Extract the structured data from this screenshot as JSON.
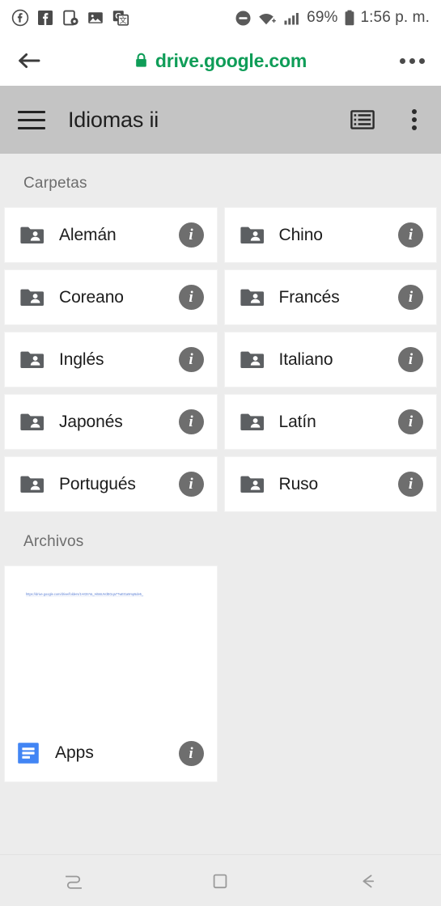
{
  "status_bar": {
    "icons_left": [
      {
        "name": "facebook-circle-icon",
        "glyph": "f"
      },
      {
        "name": "facebook-square-icon",
        "glyph": "f"
      },
      {
        "name": "screen-recorder-icon",
        "glyph": "□"
      },
      {
        "name": "photos-icon",
        "glyph": "ὛC"
      },
      {
        "name": "google-translate-icon",
        "glyph": "G"
      }
    ],
    "do_not_disturb": "do-not-disturb-icon",
    "wifi": "wifi-icon",
    "signal": "cellular-signal-icon",
    "battery_percent": "69%",
    "battery_icon": "battery-icon",
    "time": "1:56 p. m."
  },
  "browser": {
    "back_label": "back-arrow",
    "lock_label": "secure-lock",
    "url": "drive.google.com",
    "url_color": "#0f9d58",
    "menu_label": "browser-overflow-menu"
  },
  "app_bar": {
    "menu_label": "menu",
    "title": "Idiomas ii",
    "view_toggle_label": "list-view",
    "overflow_label": "more-options",
    "background": "#c4c4c4"
  },
  "folders_section": {
    "header": "Carpetas",
    "items": [
      {
        "label": "Alemán",
        "icon": "shared-folder-icon",
        "info": "info-icon"
      },
      {
        "label": "Chino",
        "icon": "shared-folder-icon",
        "info": "info-icon"
      },
      {
        "label": "Coreano",
        "icon": "shared-folder-icon",
        "info": "info-icon"
      },
      {
        "label": "Francés",
        "icon": "shared-folder-icon",
        "info": "info-icon"
      },
      {
        "label": "Inglés",
        "icon": "shared-folder-icon",
        "info": "info-icon"
      },
      {
        "label": "Italiano",
        "icon": "shared-folder-icon",
        "info": "info-icon"
      },
      {
        "label": "Japonés",
        "icon": "shared-folder-icon",
        "info": "info-icon"
      },
      {
        "label": "Latín",
        "icon": "shared-folder-icon",
        "info": "info-icon"
      },
      {
        "label": "Portugués",
        "icon": "shared-folder-icon",
        "info": "info-icon"
      },
      {
        "label": "Ruso",
        "icon": "shared-folder-icon",
        "info": "info-icon"
      }
    ]
  },
  "files_section": {
    "header": "Archivos",
    "items": [
      {
        "name": "Apps",
        "icon": "google-docs-icon",
        "icon_color": "#4285F4",
        "thumbnail_text": "https://drive.google.com/drive/folders/1Hr3SYa_Hi56UVdEGqa77wEGa9mp5de5_",
        "info": "info-icon"
      }
    ]
  },
  "nav_bar": {
    "recents_label": "recent-apps",
    "home_label": "home",
    "back_label": "back"
  }
}
